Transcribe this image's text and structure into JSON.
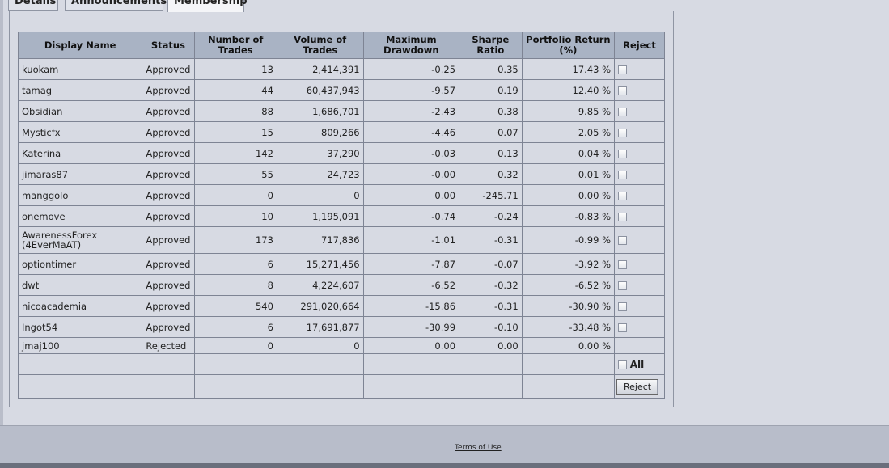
{
  "tabs": [
    {
      "label": "Details"
    },
    {
      "label": "Announcements"
    },
    {
      "label": "Membership"
    }
  ],
  "table": {
    "headers": [
      "Display Name",
      "Status",
      "Number of Trades",
      "Volume of Trades",
      "Maximum Drawdown",
      "Sharpe Ratio",
      "Portfolio Return (%)",
      "Reject"
    ],
    "rows": [
      {
        "name": "kuokam",
        "status": "Approved",
        "trades": "13",
        "volume": "2,414,391",
        "drawdown": "-0.25",
        "sharpe": "0.35",
        "return": "17.43 %",
        "checkbox": true
      },
      {
        "name": "tamag",
        "status": "Approved",
        "trades": "44",
        "volume": "60,437,943",
        "drawdown": "-9.57",
        "sharpe": "0.19",
        "return": "12.40 %",
        "checkbox": true
      },
      {
        "name": "Obsidian",
        "status": "Approved",
        "trades": "88",
        "volume": "1,686,701",
        "drawdown": "-2.43",
        "sharpe": "0.38",
        "return": "9.85 %",
        "checkbox": true
      },
      {
        "name": "Mysticfx",
        "status": "Approved",
        "trades": "15",
        "volume": "809,266",
        "drawdown": "-4.46",
        "sharpe": "0.07",
        "return": "2.05 %",
        "checkbox": true
      },
      {
        "name": "Katerina",
        "status": "Approved",
        "trades": "142",
        "volume": "37,290",
        "drawdown": "-0.03",
        "sharpe": "0.13",
        "return": "0.04 %",
        "checkbox": true
      },
      {
        "name": "jimaras87",
        "status": "Approved",
        "trades": "55",
        "volume": "24,723",
        "drawdown": "-0.00",
        "sharpe": "0.32",
        "return": "0.01 %",
        "checkbox": true
      },
      {
        "name": "manggolo",
        "status": "Approved",
        "trades": "0",
        "volume": "0",
        "drawdown": "0.00",
        "sharpe": "-245.71",
        "return": "0.00 %",
        "checkbox": true
      },
      {
        "name": "onemove",
        "status": "Approved",
        "trades": "10",
        "volume": "1,195,091",
        "drawdown": "-0.74",
        "sharpe": "-0.24",
        "return": "-0.83 %",
        "checkbox": true
      },
      {
        "name": "AwarenessForex (4EverMaAT)",
        "status": "Approved",
        "trades": "173",
        "volume": "717,836",
        "drawdown": "-1.01",
        "sharpe": "-0.31",
        "return": "-0.99 %",
        "checkbox": true
      },
      {
        "name": "optiontimer",
        "status": "Approved",
        "trades": "6",
        "volume": "15,271,456",
        "drawdown": "-7.87",
        "sharpe": "-0.07",
        "return": "-3.92 %",
        "checkbox": true
      },
      {
        "name": "dwt",
        "status": "Approved",
        "trades": "8",
        "volume": "4,224,607",
        "drawdown": "-6.52",
        "sharpe": "-0.32",
        "return": "-6.52 %",
        "checkbox": true
      },
      {
        "name": "nicoacademia",
        "status": "Approved",
        "trades": "540",
        "volume": "291,020,664",
        "drawdown": "-15.86",
        "sharpe": "-0.31",
        "return": "-30.90 %",
        "checkbox": true
      },
      {
        "name": "Ingot54",
        "status": "Approved",
        "trades": "6",
        "volume": "17,691,877",
        "drawdown": "-30.99",
        "sharpe": "-0.10",
        "return": "-33.48 %",
        "checkbox": true
      },
      {
        "name": "jmaj100",
        "status": "Rejected",
        "trades": "0",
        "volume": "0",
        "drawdown": "0.00",
        "sharpe": "0.00",
        "return": "0.00 %",
        "checkbox": false
      }
    ],
    "all_label": "All",
    "reject_button_label": "Reject"
  },
  "footer": {
    "terms_label": "Terms of Use"
  }
}
